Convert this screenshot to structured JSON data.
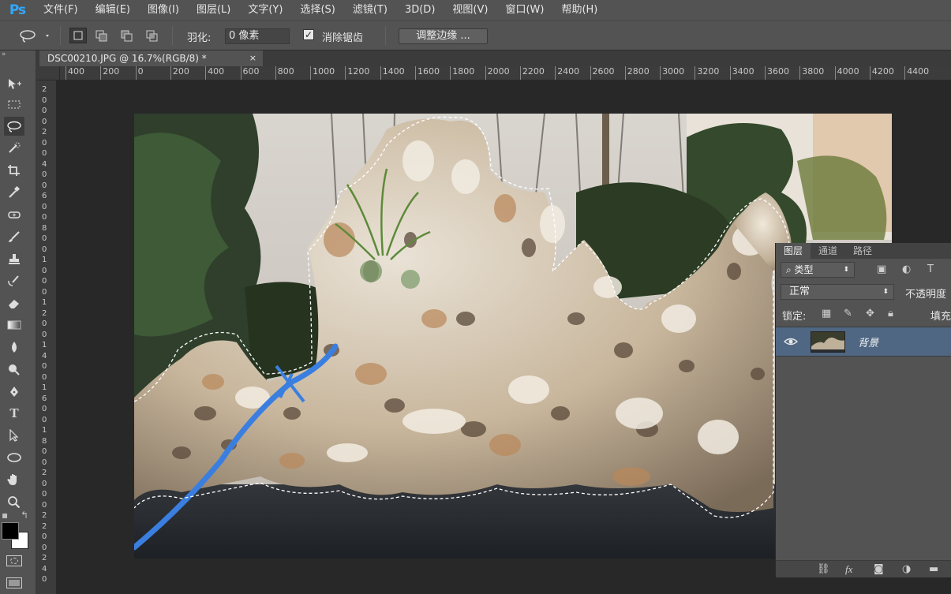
{
  "app": {
    "logo": "Ps"
  },
  "menu": [
    "文件(F)",
    "编辑(E)",
    "图像(I)",
    "图层(L)",
    "文字(Y)",
    "选择(S)",
    "滤镜(T)",
    "3D(D)",
    "视图(V)",
    "窗口(W)",
    "帮助(H)"
  ],
  "options": {
    "feather_label": "羽化:",
    "feather_value": "0 像素",
    "antialias_label": "消除锯齿",
    "antialias_checked": true,
    "refine_edge": "调整边缘 ..."
  },
  "document": {
    "tab_title": "DSC00210.JPG @ 16.7%(RGB/8) *",
    "close": "×"
  },
  "rulers": {
    "horizontal": [
      "400",
      "200",
      "0",
      "200",
      "400",
      "600",
      "800",
      "1000",
      "1200",
      "1400",
      "1600",
      "1800",
      "2000",
      "2200",
      "2400",
      "2600",
      "2800",
      "3000",
      "3200",
      "3400",
      "3600",
      "3800",
      "4000",
      "4200",
      "4400"
    ],
    "vertical": [
      "2",
      "0",
      "0",
      "0",
      "2",
      "0",
      "0",
      "4",
      "0",
      "0",
      "6",
      "0",
      "0",
      "8",
      "0",
      "0",
      "1",
      "0",
      "0",
      "0",
      "1",
      "2",
      "0",
      "0",
      "1",
      "4",
      "0",
      "0",
      "1",
      "6",
      "0",
      "0",
      "1",
      "8",
      "0",
      "0",
      "2",
      "0",
      "0",
      "0",
      "2",
      "2",
      "0",
      "0",
      "2",
      "4",
      "0",
      "0"
    ]
  },
  "layers_panel": {
    "tabs": [
      "图层",
      "通道",
      "路径"
    ],
    "filter": "类型",
    "blend_mode": "正常",
    "opacity_label": "不透明度",
    "lock_label": "锁定:",
    "fill_label": "填充",
    "layer": {
      "name": "背景",
      "visible": true
    }
  },
  "colors": {
    "ui_bg": "#535353",
    "canvas_bg": "#282828",
    "selected_layer": "#4f6782",
    "ps_blue": "#31a8ff",
    "hose_blue": "#3a7fe0"
  },
  "tools": [
    "move-tool",
    "marquee-tool",
    "lasso-tool",
    "quick-selection-tool",
    "crop-tool",
    "eyedropper-tool",
    "healing-brush-tool",
    "brush-tool",
    "clone-stamp-tool",
    "history-brush-tool",
    "eraser-tool",
    "gradient-tool",
    "blur-tool",
    "dodge-tool",
    "pen-tool",
    "type-tool",
    "path-selection-tool",
    "shape-tool",
    "hand-tool",
    "zoom-tool"
  ]
}
